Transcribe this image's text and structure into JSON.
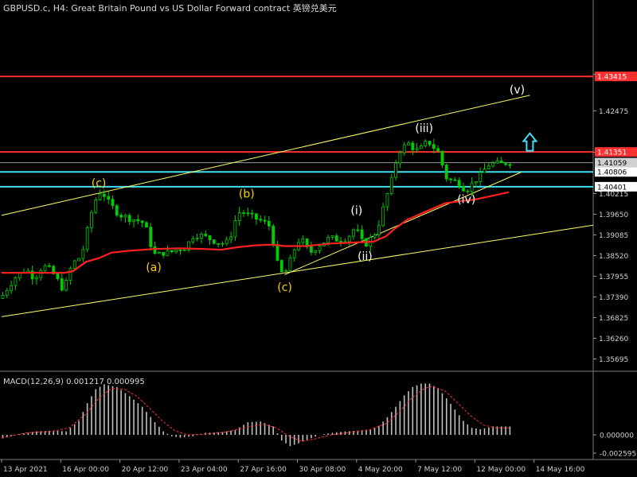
{
  "chart_title": "GBPUSD.c, H4:  Great Britain Pound vs US Dollar Forward contract  英镑兑美元",
  "colors": {
    "background": "#000000",
    "candles": "#00cc00",
    "ma": "#ff2020",
    "trendline": "#ffff66",
    "resistance": "#ff3030",
    "support": "#40e0f0",
    "price_line": "#9a9a9a",
    "macd_hist": "#c0c0c0",
    "macd_signal": "#ff3030",
    "arrow": "#40e0f0",
    "wave_yellow": "#ffd000",
    "wave_white": "#ffffff"
  },
  "chart_data": {
    "type": "candlestick",
    "main": {
      "ylim": [
        1.3538,
        1.4546
      ],
      "y_ticks": [
        "1.43470",
        "1.42475",
        "1.41345",
        "1.40215",
        "1.39650",
        "1.39085",
        "1.38520",
        "1.37955",
        "1.37390",
        "1.36825",
        "1.36260",
        "1.35695"
      ],
      "close_path": [
        [
          0,
          1.3735
        ],
        [
          2,
          1.377
        ],
        [
          4,
          1.38
        ],
        [
          6,
          1.3815
        ],
        [
          8,
          1.379
        ],
        [
          10,
          1.3825
        ],
        [
          12,
          1.381
        ],
        [
          14,
          1.3775
        ],
        [
          15,
          1.3755
        ],
        [
          16,
          1.38
        ],
        [
          17,
          1.383
        ],
        [
          19,
          1.385
        ],
        [
          20,
          1.389
        ],
        [
          21,
          1.395
        ],
        [
          22,
          1.399
        ],
        [
          23,
          1.402
        ],
        [
          24,
          1.403
        ],
        [
          25,
          1.4005
        ],
        [
          26,
          1.399
        ],
        [
          28,
          1.3965
        ],
        [
          30,
          1.3955
        ],
        [
          32,
          1.395
        ],
        [
          34,
          1.394
        ],
        [
          35,
          1.3905
        ],
        [
          36,
          1.386
        ],
        [
          37,
          1.385
        ],
        [
          38,
          1.386
        ],
        [
          40,
          1.386
        ],
        [
          42,
          1.387
        ],
        [
          44,
          1.3875
        ],
        [
          45,
          1.39
        ],
        [
          46,
          1.391
        ],
        [
          48,
          1.3905
        ],
        [
          50,
          1.3895
        ],
        [
          52,
          1.3885
        ],
        [
          54,
          1.389
        ],
        [
          55,
          1.393
        ],
        [
          56,
          1.3965
        ],
        [
          57,
          1.3975
        ],
        [
          58,
          1.3965
        ],
        [
          60,
          1.3955
        ],
        [
          62,
          1.3945
        ],
        [
          64,
          1.393
        ],
        [
          65,
          1.385
        ],
        [
          66,
          1.381
        ],
        [
          67,
          1.38
        ],
        [
          68,
          1.382
        ],
        [
          69,
          1.3855
        ],
        [
          70,
          1.3885
        ],
        [
          71,
          1.39
        ],
        [
          72,
          1.388
        ],
        [
          73,
          1.386
        ],
        [
          74,
          1.3865
        ],
        [
          75,
          1.388
        ],
        [
          76,
          1.3885
        ],
        [
          77,
          1.3895
        ],
        [
          78,
          1.39
        ],
        [
          80,
          1.3895
        ],
        [
          82,
          1.39
        ],
        [
          84,
          1.393
        ],
        [
          85,
          1.39
        ],
        [
          86,
          1.388
        ],
        [
          87,
          1.389
        ],
        [
          88,
          1.3905
        ],
        [
          89,
          1.392
        ],
        [
          90,
          1.396
        ],
        [
          91,
          1.4
        ],
        [
          92,
          1.404
        ],
        [
          93,
          1.4075
        ],
        [
          94,
          1.414
        ],
        [
          95,
          1.414
        ],
        [
          96,
          1.416
        ],
        [
          97,
          1.4155
        ],
        [
          98,
          1.414
        ],
        [
          99,
          1.414
        ],
        [
          100,
          1.415
        ],
        [
          101,
          1.4165
        ],
        [
          102,
          1.4155
        ],
        [
          103,
          1.414
        ],
        [
          104,
          1.413
        ],
        [
          105,
          1.407
        ],
        [
          106,
          1.406
        ],
        [
          107,
          1.4055
        ],
        [
          108,
          1.4055
        ],
        [
          109,
          1.4045
        ],
        [
          110,
          1.403
        ],
        [
          111,
          1.404
        ],
        [
          112,
          1.4055
        ],
        [
          113,
          1.4065
        ],
        [
          114,
          1.4075
        ],
        [
          115,
          1.41
        ],
        [
          116,
          1.41
        ],
        [
          117,
          1.4105
        ],
        [
          118,
          1.41
        ],
        [
          119,
          1.4105
        ],
        [
          120,
          1.4106
        ]
      ],
      "ma_path": [
        [
          0,
          1.3805
        ],
        [
          15,
          1.3805
        ],
        [
          17,
          1.381
        ],
        [
          20,
          1.3835
        ],
        [
          23,
          1.3845
        ],
        [
          26,
          1.386
        ],
        [
          30,
          1.3865
        ],
        [
          36,
          1.387
        ],
        [
          42,
          1.3872
        ],
        [
          48,
          1.387
        ],
        [
          52,
          1.3868
        ],
        [
          56,
          1.3875
        ],
        [
          60,
          1.388
        ],
        [
          64,
          1.3882
        ],
        [
          67,
          1.3878
        ],
        [
          72,
          1.3878
        ],
        [
          78,
          1.3885
        ],
        [
          84,
          1.3888
        ],
        [
          88,
          1.389
        ],
        [
          91,
          1.3905
        ],
        [
          93,
          1.3925
        ],
        [
          96,
          1.395
        ],
        [
          99,
          1.3965
        ],
        [
          102,
          1.398
        ],
        [
          105,
          1.3995
        ],
        [
          108,
          1.4
        ],
        [
          112,
          1.4005
        ],
        [
          116,
          1.4015
        ],
        [
          120,
          1.4025
        ]
      ],
      "trendlines": [
        {
          "from": [
            0,
            1.3962
          ],
          "to": [
            125,
            1.429
          ]
        },
        {
          "from": [
            0,
            1.3685
          ],
          "to": [
            140,
            1.3935
          ]
        },
        {
          "from": [
            67,
            1.38
          ],
          "to": [
            123,
            1.408
          ]
        }
      ],
      "hlines": [
        {
          "price": 1.43415,
          "label": "1.43415",
          "kind": "resistance"
        },
        {
          "price": 1.41351,
          "label": "1.41351",
          "kind": "resistance"
        },
        {
          "price": 1.40806,
          "label": "1.40806",
          "kind": "support"
        },
        {
          "price": 1.40401,
          "label": "1.40401",
          "kind": "support"
        },
        {
          "price": 1.41059,
          "label": "1.41059",
          "kind": "price"
        }
      ],
      "wave_labels": [
        {
          "text": "(c)",
          "x": 23,
          "price": 1.404,
          "color": "yellow"
        },
        {
          "text": "(b)",
          "x": 58,
          "price": 1.401,
          "color": "yellow"
        },
        {
          "text": "(a)",
          "x": 36,
          "price": 1.381,
          "color": "yellow"
        },
        {
          "text": "(c)",
          "x": 67,
          "price": 1.3755,
          "color": "yellow"
        },
        {
          "text": "(i)",
          "x": 84,
          "price": 1.3965,
          "color": "white"
        },
        {
          "text": "(ii)",
          "x": 86,
          "price": 1.384,
          "color": "white"
        },
        {
          "text": "(iii)",
          "x": 100,
          "price": 1.419,
          "color": "white"
        },
        {
          "text": "(iv)",
          "x": 110,
          "price": 1.3995,
          "color": "white"
        },
        {
          "text": "(v)",
          "x": 122,
          "price": 1.4295,
          "color": "white"
        }
      ],
      "arrow": {
        "x": 125,
        "price": 1.416,
        "direction": "up"
      }
    },
    "macd": {
      "title": "MACD(12,26,9) 0.001217 0.000995",
      "ylim": [
        -0.0035,
        0.0087
      ],
      "y_ticks": [
        "0.000000",
        "-0.002595"
      ],
      "hist_path": [
        [
          0,
          -0.0005
        ],
        [
          4,
          0.0001
        ],
        [
          8,
          0.0005
        ],
        [
          12,
          0.0006
        ],
        [
          15,
          0.0005
        ],
        [
          18,
          0.002
        ],
        [
          20,
          0.0045
        ],
        [
          22,
          0.0065
        ],
        [
          24,
          0.0072
        ],
        [
          27,
          0.0068
        ],
        [
          30,
          0.0055
        ],
        [
          33,
          0.004
        ],
        [
          36,
          0.0018
        ],
        [
          38,
          0.0005
        ],
        [
          40,
          -0.0002
        ],
        [
          42,
          -0.0004
        ],
        [
          45,
          -0.0002
        ],
        [
          48,
          0.0003
        ],
        [
          52,
          0.0004
        ],
        [
          55,
          0.0007
        ],
        [
          58,
          0.0018
        ],
        [
          61,
          0.0019
        ],
        [
          64,
          0.0012
        ],
        [
          66,
          -0.0008
        ],
        [
          68,
          -0.0016
        ],
        [
          70,
          -0.0012
        ],
        [
          72,
          -0.0007
        ],
        [
          75,
          0.0
        ],
        [
          78,
          0.0003
        ],
        [
          81,
          0.0005
        ],
        [
          84,
          0.0006
        ],
        [
          87,
          0.0008
        ],
        [
          89,
          0.0013
        ],
        [
          91,
          0.0025
        ],
        [
          93,
          0.004
        ],
        [
          95,
          0.0056
        ],
        [
          97,
          0.0068
        ],
        [
          99,
          0.0073
        ],
        [
          101,
          0.0073
        ],
        [
          103,
          0.0066
        ],
        [
          105,
          0.0052
        ],
        [
          107,
          0.0036
        ],
        [
          109,
          0.002
        ],
        [
          111,
          0.001
        ],
        [
          113,
          0.0008
        ],
        [
          116,
          0.0012
        ],
        [
          118,
          0.0012
        ],
        [
          120,
          0.0012
        ]
      ],
      "signal_path": [
        [
          0,
          -0.0004
        ],
        [
          6,
          0.0003
        ],
        [
          12,
          0.0005
        ],
        [
          16,
          0.001
        ],
        [
          20,
          0.003
        ],
        [
          23,
          0.0052
        ],
        [
          26,
          0.0066
        ],
        [
          29,
          0.0065
        ],
        [
          32,
          0.0055
        ],
        [
          35,
          0.0038
        ],
        [
          38,
          0.002
        ],
        [
          41,
          0.0006
        ],
        [
          44,
          0.0
        ],
        [
          48,
          0.0001
        ],
        [
          53,
          0.0004
        ],
        [
          58,
          0.0011
        ],
        [
          62,
          0.0015
        ],
        [
          65,
          0.001
        ],
        [
          68,
          -0.0002
        ],
        [
          71,
          -0.0009
        ],
        [
          74,
          -0.0006
        ],
        [
          78,
          0.0
        ],
        [
          83,
          0.0004
        ],
        [
          87,
          0.0007
        ],
        [
          91,
          0.0016
        ],
        [
          94,
          0.0032
        ],
        [
          97,
          0.0052
        ],
        [
          100,
          0.0066
        ],
        [
          102,
          0.0069
        ],
        [
          105,
          0.0062
        ],
        [
          108,
          0.0045
        ],
        [
          111,
          0.0027
        ],
        [
          114,
          0.0014
        ],
        [
          117,
          0.001
        ],
        [
          120,
          0.001
        ]
      ]
    },
    "x_ticks": [
      "13 Apr 2021",
      "16 Apr 00:00",
      "20 Apr 12:00",
      "23 Apr 04:00",
      "27 Apr 16:00",
      "30 Apr 08:00",
      "4 May 20:00",
      "7 May 12:00",
      "12 May 00:00",
      "14 May 16:00"
    ]
  }
}
